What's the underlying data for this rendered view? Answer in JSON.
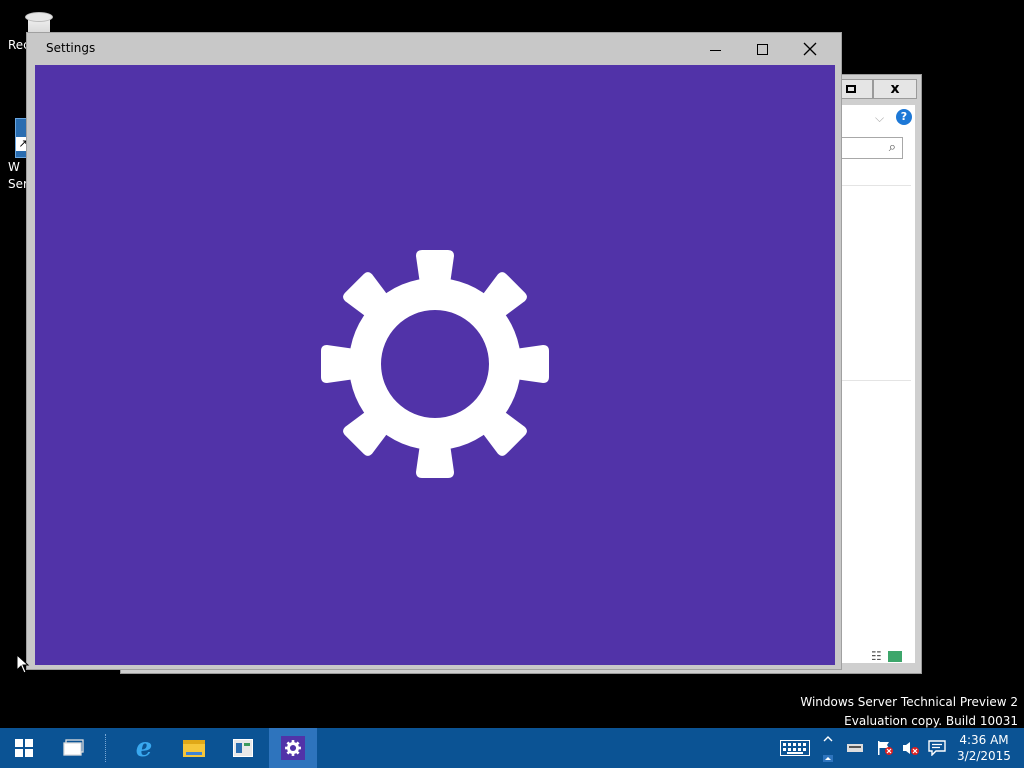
{
  "desktop": {
    "recycle_bin_label": "Rec",
    "server_icon_label_1": "W",
    "server_icon_label_2": "Ser"
  },
  "background_window": {
    "minimize_symbol": "‒",
    "close_symbol": "x",
    "help_symbol": "?"
  },
  "settings_window": {
    "title": "Settings",
    "background_color": "#5133a8",
    "icon": "gear-icon"
  },
  "watermark": {
    "line1": "Windows Server Technical Preview 2",
    "line2": "Evaluation copy. Build 10031"
  },
  "taskbar": {
    "background_color": "#0b5394",
    "apps": [
      {
        "name": "start",
        "icon": "windows-logo-icon"
      },
      {
        "name": "task-view",
        "icon": "task-view-icon"
      },
      {
        "name": "internet-explorer",
        "icon": "ie-icon"
      },
      {
        "name": "file-explorer",
        "icon": "folder-icon"
      },
      {
        "name": "server-manager",
        "icon": "server-manager-icon"
      },
      {
        "name": "settings",
        "icon": "gear-icon",
        "active": true
      }
    ],
    "tray": {
      "time": "4:36 AM",
      "date": "3/2/2015"
    }
  }
}
